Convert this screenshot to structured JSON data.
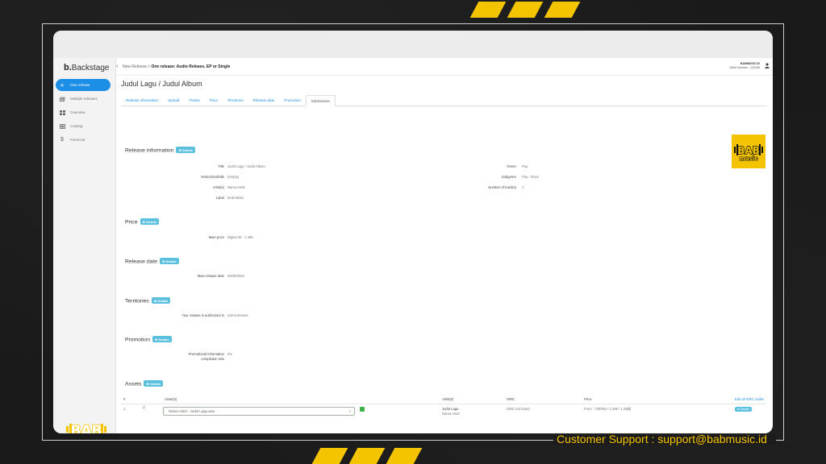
{
  "colors": {
    "accent": "#1d8ee6",
    "details": "#5bc0de",
    "brand_yellow": "#f5c400"
  },
  "support": "Customer Support : support@babmusic.id",
  "app": {
    "logo_prefix": "b.",
    "logo_name": "Backstage"
  },
  "sidebar": {
    "items": [
      {
        "label": "One release",
        "icon": "plus-icon"
      },
      {
        "label": "Multiple releases",
        "icon": "stack-icon"
      },
      {
        "label": "Overview",
        "icon": "grid-icon"
      },
      {
        "label": "Catalog",
        "icon": "catalog-icon"
      },
      {
        "label": "Financial",
        "icon": "dollar-icon"
      }
    ]
  },
  "header": {
    "back": "‹",
    "crumb_parent": "New Release >",
    "crumb_current": "One release: Audio Release, EP or Single",
    "account_name": "BABMUSIC.ID",
    "client_number": "Client Number : 123456"
  },
  "page": {
    "title": "Judul Lagu / Judul Album",
    "tabs": [
      "Release information",
      "Upload",
      "Tracks",
      "Price",
      "Territories",
      "Release date",
      "Promotion",
      "Submission"
    ],
    "details_label": "Details"
  },
  "release_info": {
    "title": "Release information",
    "rows_left": [
      {
        "label": "Title",
        "value": "Judul Lagu / Judul Album"
      },
      {
        "label": "Version/Subtitle",
        "value": "(empty)"
      },
      {
        "label": "Artist(s)",
        "value": "Nama Artist"
      },
      {
        "label": "Label",
        "value": "BAB Music"
      }
    ],
    "rows_right": [
      {
        "label": "Genre",
        "value": "Pop"
      },
      {
        "label": "Subgenre",
        "value": "Pop - Rock"
      },
      {
        "label": "Number of track(s)",
        "value": "1"
      }
    ]
  },
  "price": {
    "title": "Price",
    "label": "Main price",
    "value": "Digital 45 - 1.49€"
  },
  "release_date": {
    "title": "Release date",
    "label": "Main release date",
    "value": "08/28/2022"
  },
  "territories": {
    "title": "Territories",
    "label": "Your release is authorized in",
    "value": "240 territories"
  },
  "promotion": {
    "title": "Promotion",
    "label_1": "Promotional information",
    "label_2": "completion rate",
    "value": "0%"
  },
  "assets": {
    "title": "Assets",
    "headers": [
      "#",
      "Asset(s)",
      "Artist(s)",
      "ISRC",
      "Price"
    ],
    "edit_isrc": "Edit all ISRC codes",
    "row": {
      "num": "1",
      "asset": "Nama Artist - Judul Lagu.wav",
      "artist_title": "Judul Lagu",
      "artist_name": "Nama Artist",
      "isrc": "ISRC not found",
      "price": "From : 7000Rp / 1.29€ / 1.49$β",
      "badge": "Details"
    }
  },
  "bab_logo": {
    "top": "BAB",
    "bottom": "music"
  }
}
